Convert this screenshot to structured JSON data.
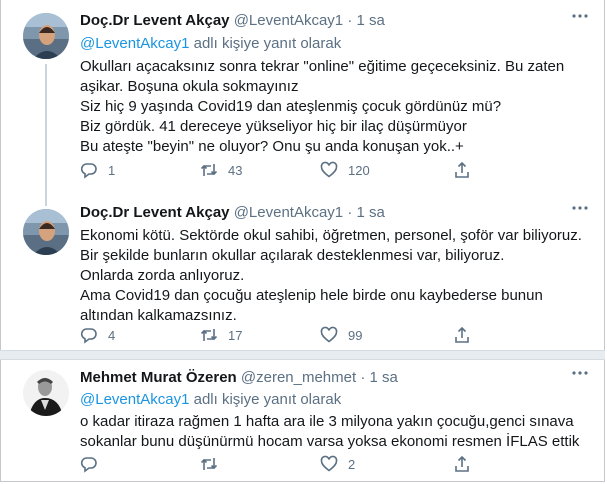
{
  "tweets": [
    {
      "name": "Doç.Dr Levent Akçay",
      "handle": "@LeventAkcay1",
      "dot": "·",
      "time": "1 sa",
      "reply_mention": "@LeventAkcay1",
      "reply_suffix": " adlı kişiye yanıt olarak",
      "text": "Okulları açacaksınız sonra tekrar \"online\" eğitime geçeceksiniz. Bu zaten aşikar. Boşuna okula sokmayınız\nSiz hiç 9 yaşında Covid19 dan ateşlenmiş çocuk gördünüz mü?\nBiz gördük. 41 dereceye yükseliyor hiç bir ilaç düşürmüyor\nBu ateşte \"beyin\" ne oluyor? Onu şu anda konuşan yok..+",
      "reply_count": "1",
      "retweet_count": "43",
      "like_count": "120"
    },
    {
      "name": "Doç.Dr Levent Akçay",
      "handle": "@LeventAkcay1",
      "dot": "·",
      "time": "1 sa",
      "text": "Ekonomi kötü. Sektörde okul sahibi, öğretmen, personel, şoför var biliyoruz.\nBir şekilde bunların okullar açılarak desteklenmesi var, biliyoruz.\nOnlarda zorda anlıyoruz.\nAma Covid19 dan çocuğu ateşlenip hele birde onu kaybederse bunun altından kalkamazsınız.",
      "reply_count": "4",
      "retweet_count": "17",
      "like_count": "99"
    },
    {
      "name": "Mehmet Murat Özeren",
      "handle": "@zeren_mehmet",
      "dot": "·",
      "time": "1 sa",
      "reply_mention": "@LeventAkcay1",
      "reply_suffix": " adlı kişiye yanıt olarak",
      "text": "o kadar itiraza rağmen 1 hafta ara ile 3 milyona yakın çocuğu,genci sınava sokanlar bunu düşünürmü hocam varsa yoksa ekonomi resmen İFLAS ettik",
      "reply_count": "",
      "retweet_count": "",
      "like_count": "2"
    }
  ],
  "colors": {
    "accent": "#1b95e0",
    "muted": "#5b7083",
    "text": "#14171a",
    "divider": "#e6ecf0"
  },
  "icons": [
    "reply-icon",
    "retweet-icon",
    "like-icon",
    "share-icon",
    "more-icon"
  ]
}
